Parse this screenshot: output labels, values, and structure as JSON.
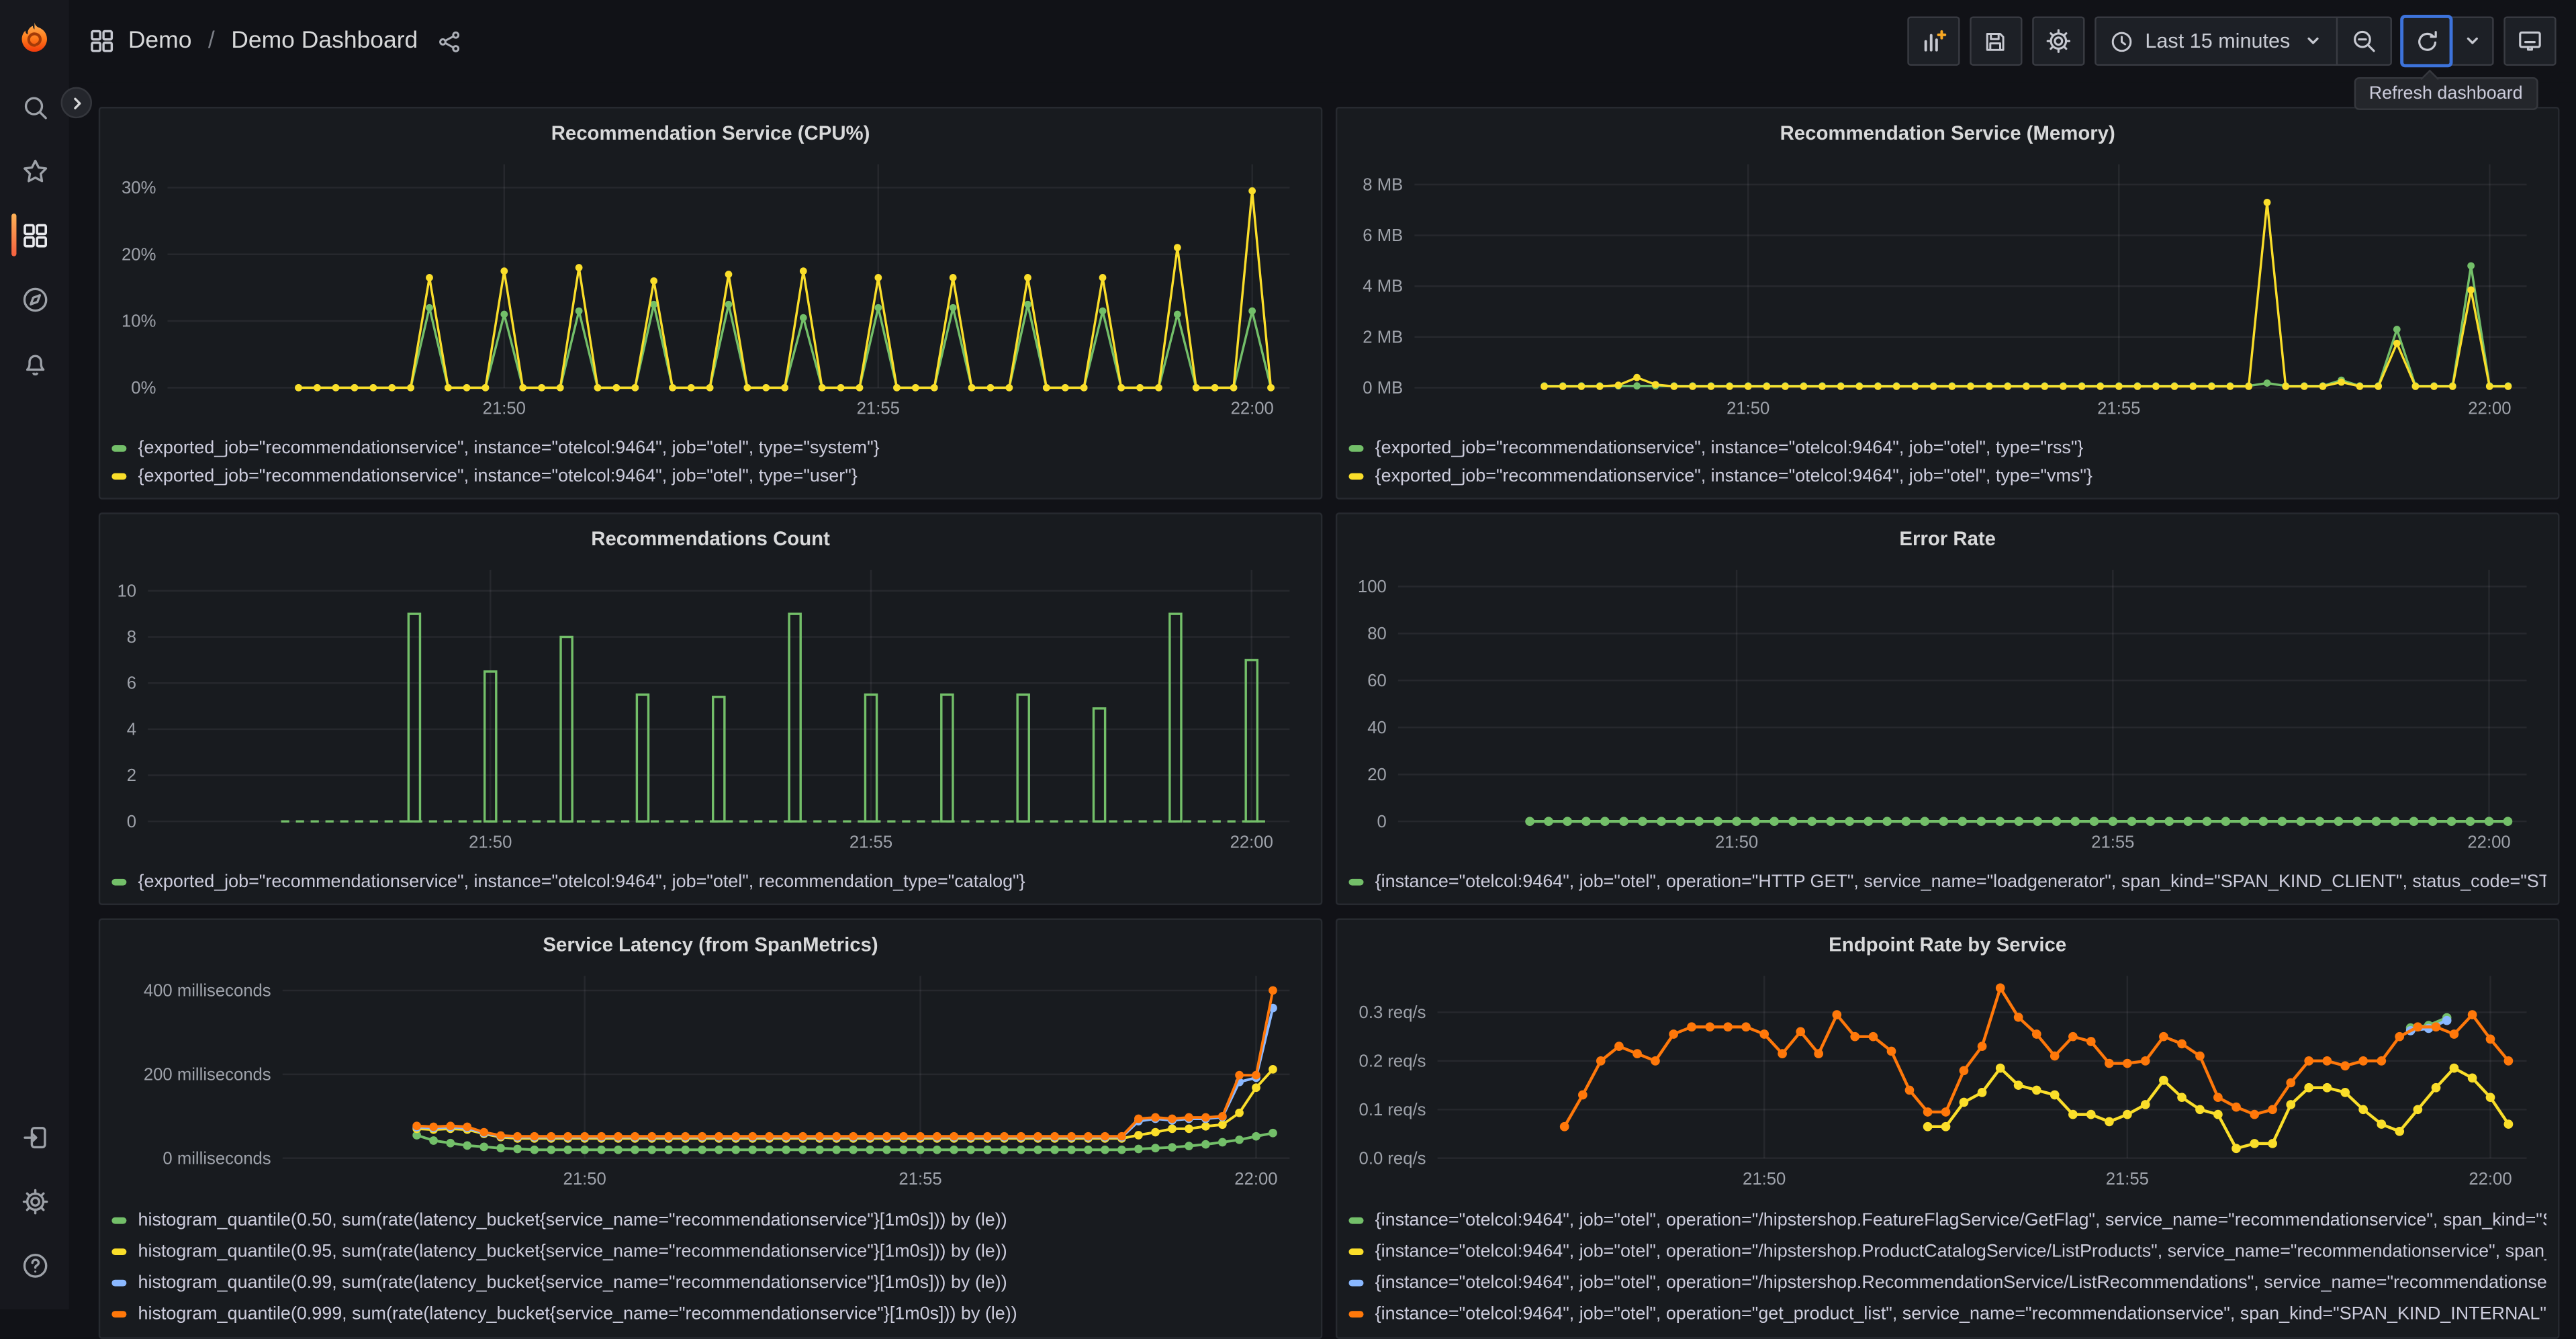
{
  "nav": {
    "section": "Demo",
    "separator": "/",
    "page": "Demo Dashboard"
  },
  "toolbar": {
    "time_label": "Last 15 minutes",
    "tooltip": "Refresh dashboard"
  },
  "sidebar": {
    "items": [
      "search",
      "starred",
      "dashboards",
      "explore",
      "alerting"
    ],
    "bottom_items": [
      "sign-in",
      "settings",
      "help"
    ],
    "active": "dashboards"
  },
  "colors": {
    "green": "#73BF69",
    "yellow": "#FADE2A",
    "blue": "#8AB8FF",
    "orange": "#FF780A",
    "accent_orange": "#FF8833",
    "focus_blue": "#3D73DB",
    "panel_bg": "#181B1F",
    "page_bg": "#111217"
  },
  "chart_data": [
    {
      "id": "cpu",
      "type": "line",
      "title": "Recommendation Service (CPU%)",
      "x_domain": [
        0,
        15
      ],
      "x_ticks": [
        {
          "t": 4.5,
          "label": "21:50"
        },
        {
          "t": 9.5,
          "label": "21:55"
        },
        {
          "t": 14.5,
          "label": "22:00"
        }
      ],
      "y_domain": [
        0,
        33.5
      ],
      "y_ticks": [
        {
          "v": 0,
          "label": "0%"
        },
        {
          "v": 10,
          "label": "10%"
        },
        {
          "v": 20,
          "label": "20%"
        },
        {
          "v": 30,
          "label": "30%"
        }
      ],
      "series": [
        {
          "name": "{exported_job=\"recommendationservice\", instance=\"otelcol:9464\", job=\"otel\", type=\"system\"}",
          "color": "#73BF69",
          "spikes": {
            "times": [
              3.5,
              4.5,
              5.5,
              6.5,
              7.5,
              8.5,
              9.5,
              10.5,
              11.5,
              12.5,
              13.5,
              14.5
            ],
            "values": [
              12,
              11,
              11.5,
              12.5,
              12.5,
              10.5,
              12,
              12,
              12.5,
              11.5,
              11,
              11.5
            ],
            "zero_from": 1.75,
            "zero_to": 14.75,
            "step": 0.25
          }
        },
        {
          "name": "{exported_job=\"recommendationservice\", instance=\"otelcol:9464\", job=\"otel\", type=\"user\"}",
          "color": "#FADE2A",
          "spikes": {
            "times": [
              3.5,
              4.5,
              5.5,
              6.5,
              7.5,
              8.5,
              9.5,
              10.5,
              11.5,
              12.5,
              13.5,
              14.5
            ],
            "values": [
              16.5,
              17.5,
              18,
              16,
              17,
              17.5,
              16.5,
              16.5,
              16.5,
              16.5,
              21,
              29.5
            ],
            "zero_from": 1.75,
            "zero_to": 14.75,
            "step": 0.25
          }
        }
      ]
    },
    {
      "id": "memory",
      "type": "line",
      "title": "Recommendation Service (Memory)",
      "x_domain": [
        0,
        15
      ],
      "x_ticks": [
        {
          "t": 4.5,
          "label": "21:50"
        },
        {
          "t": 9.5,
          "label": "21:55"
        },
        {
          "t": 14.5,
          "label": "22:00"
        }
      ],
      "y_domain": [
        0,
        8.8
      ],
      "y_ticks": [
        {
          "v": 0,
          "label": "0 MB"
        },
        {
          "v": 2,
          "label": "2 MB"
        },
        {
          "v": 4,
          "label": "4 MB"
        },
        {
          "v": 6,
          "label": "6 MB"
        },
        {
          "v": 8,
          "label": "8 MB"
        }
      ],
      "series": [
        {
          "name": "{exported_job=\"recommendationservice\", instance=\"otelcol:9464\", job=\"otel\", type=\"rss\"}",
          "color": "#73BF69",
          "flat": [
            {
              "from": 1.75,
              "to": 14.75,
              "step": 0.25,
              "value": 0.07
            }
          ],
          "points": [
            [
              11.5,
              0.18
            ],
            [
              12.5,
              0.3
            ],
            [
              13.25,
              2.3
            ],
            [
              14.25,
              4.8
            ]
          ]
        },
        {
          "name": "{exported_job=\"recommendationservice\", instance=\"otelcol:9464\", job=\"otel\", type=\"vms\"}",
          "color": "#FADE2A",
          "flat": [
            {
              "from": 1.75,
              "to": 14.75,
              "step": 0.25,
              "value": 0.05
            }
          ],
          "points": [
            [
              2.75,
              0.1
            ],
            [
              3,
              0.4
            ],
            [
              3.25,
              0.12
            ],
            [
              11.5,
              7.3
            ],
            [
              12.5,
              0.22
            ],
            [
              13.25,
              1.75
            ],
            [
              14.25,
              3.85
            ]
          ]
        }
      ]
    },
    {
      "id": "count",
      "type": "bar",
      "title": "Recommendations Count",
      "x_domain": [
        0,
        15
      ],
      "x_ticks": [
        {
          "t": 4.5,
          "label": "21:50"
        },
        {
          "t": 9.5,
          "label": "21:55"
        },
        {
          "t": 14.5,
          "label": "22:00"
        }
      ],
      "y_domain": [
        0,
        10.9
      ],
      "y_ticks": [
        {
          "v": 0,
          "label": "0"
        },
        {
          "v": 2,
          "label": "2"
        },
        {
          "v": 4,
          "label": "4"
        },
        {
          "v": 6,
          "label": "6"
        },
        {
          "v": 8,
          "label": "8"
        },
        {
          "v": 10,
          "label": "10"
        }
      ],
      "series": [
        {
          "name": "{exported_job=\"recommendationservice\", instance=\"otelcol:9464\", job=\"otel\", recommendation_type=\"catalog\"}",
          "color": "#73BF69",
          "bars": {
            "times": [
              3.5,
              4.5,
              5.5,
              6.5,
              7.5,
              8.5,
              9.5,
              10.5,
              11.5,
              12.5,
              13.5,
              14.5
            ],
            "values": [
              9,
              6.5,
              8,
              5.5,
              5.4,
              9,
              5.5,
              5.5,
              5.5,
              4.9,
              9,
              7
            ],
            "width": 7
          },
          "baseline": {
            "from": 1.75,
            "to": 14.75
          }
        }
      ]
    },
    {
      "id": "error_rate",
      "type": "line",
      "title": "Error Rate",
      "x_domain": [
        0,
        15
      ],
      "x_ticks": [
        {
          "t": 4.5,
          "label": "21:50"
        },
        {
          "t": 9.5,
          "label": "21:55"
        },
        {
          "t": 14.5,
          "label": "22:00"
        }
      ],
      "y_domain": [
        0,
        107
      ],
      "y_ticks": [
        {
          "v": 0,
          "label": "0"
        },
        {
          "v": 20,
          "label": "20"
        },
        {
          "v": 40,
          "label": "40"
        },
        {
          "v": 60,
          "label": "60"
        },
        {
          "v": 80,
          "label": "80"
        },
        {
          "v": 100,
          "label": "100"
        }
      ],
      "series": [
        {
          "name": "{instance=\"otelcol:9464\", job=\"otel\", operation=\"HTTP GET\", service_name=\"loadgenerator\", span_kind=\"SPAN_KIND_CLIENT\", status_code=\"STATUS_CODE_ERROR\"}",
          "color": "#73BF69",
          "flat": [
            {
              "from": 1.75,
              "to": 14.75,
              "step": 0.25,
              "value": 0
            }
          ]
        }
      ]
    },
    {
      "id": "latency",
      "type": "line",
      "title": "Service Latency (from SpanMetrics)",
      "x_domain": [
        0,
        15
      ],
      "x_ticks": [
        {
          "t": 4.5,
          "label": "21:50"
        },
        {
          "t": 9.5,
          "label": "21:55"
        },
        {
          "t": 14.5,
          "label": "22:00"
        }
      ],
      "y_domain": [
        0,
        435
      ],
      "y_ticks": [
        {
          "v": 0,
          "label": "0 milliseconds"
        },
        {
          "v": 200,
          "label": "200 milliseconds"
        },
        {
          "v": 400,
          "label": "400 milliseconds"
        }
      ],
      "series": [
        {
          "name": "histogram_quantile(0.50, sum(rate(latency_bucket{service_name=\"recommendationservice\"}[1m0s])) by (le))",
          "color": "#73BF69",
          "points": [
            [
              2,
              55
            ],
            [
              2.25,
              42
            ],
            [
              2.5,
              36
            ],
            [
              2.75,
              30
            ],
            [
              3,
              27
            ],
            [
              3.25,
              24
            ],
            [
              3.5,
              22
            ],
            [
              12.75,
              22
            ],
            [
              13,
              24
            ],
            [
              13.25,
              26
            ],
            [
              13.5,
              29
            ],
            [
              13.75,
              33
            ],
            [
              14,
              38
            ],
            [
              14.25,
              44
            ],
            [
              14.5,
              52
            ],
            [
              14.75,
              60
            ]
          ],
          "flat": [
            {
              "from": 3.75,
              "to": 12.5,
              "step": 0.25,
              "value": 20
            }
          ]
        },
        {
          "name": "histogram_quantile(0.95, sum(rate(latency_bucket{service_name=\"recommendationservice\"}[1m0s])) by (le))",
          "color": "#FADE2A",
          "points": [
            [
              2,
              70
            ],
            [
              2.25,
              68
            ],
            [
              2.5,
              70
            ],
            [
              2.75,
              68
            ],
            [
              3,
              58
            ],
            [
              3.25,
              50
            ],
            [
              12.75,
              55
            ],
            [
              13,
              62
            ],
            [
              13.25,
              70
            ],
            [
              13.5,
              70
            ],
            [
              13.75,
              76
            ],
            [
              14,
              80
            ],
            [
              14.25,
              108
            ],
            [
              14.5,
              168
            ],
            [
              14.75,
              212
            ]
          ],
          "flat": [
            {
              "from": 3.5,
              "to": 12.5,
              "step": 0.25,
              "value": 47
            }
          ]
        },
        {
          "name": "histogram_quantile(0.99, sum(rate(latency_bucket{service_name=\"recommendationservice\"}[1m0s])) by (le))",
          "color": "#8AB8FF",
          "points": [
            [
              2,
              74
            ],
            [
              2.25,
              72
            ],
            [
              2.5,
              74
            ],
            [
              2.75,
              72
            ],
            [
              3,
              60
            ],
            [
              3.25,
              52
            ],
            [
              12.75,
              88
            ],
            [
              13,
              94
            ],
            [
              13.25,
              90
            ],
            [
              13.5,
              94
            ],
            [
              13.75,
              94
            ],
            [
              14,
              98
            ],
            [
              14.25,
              182
            ],
            [
              14.5,
              192
            ],
            [
              14.75,
              358
            ]
          ],
          "flat": [
            {
              "from": 3.5,
              "to": 12.5,
              "step": 0.25,
              "value": 50
            }
          ]
        },
        {
          "name": "histogram_quantile(0.999, sum(rate(latency_bucket{service_name=\"recommendationservice\"}[1m0s])) by (le))",
          "color": "#FF780A",
          "points": [
            [
              2,
              77
            ],
            [
              2.25,
              75
            ],
            [
              2.5,
              77
            ],
            [
              2.75,
              75
            ],
            [
              3,
              62
            ],
            [
              3.25,
              54
            ],
            [
              12.75,
              94
            ],
            [
              13,
              97
            ],
            [
              13.25,
              94
            ],
            [
              13.5,
              97
            ],
            [
              13.75,
              97
            ],
            [
              14,
              100
            ],
            [
              14.25,
              198
            ],
            [
              14.5,
              198
            ],
            [
              14.75,
              400
            ]
          ],
          "flat": [
            {
              "from": 3.5,
              "to": 12.5,
              "step": 0.25,
              "value": 52
            }
          ]
        }
      ]
    },
    {
      "id": "endpoint_rate",
      "type": "line",
      "title": "Endpoint Rate by Service",
      "x_domain": [
        0,
        15
      ],
      "x_ticks": [
        {
          "t": 4.5,
          "label": "21:50"
        },
        {
          "t": 9.5,
          "label": "21:55"
        },
        {
          "t": 14.5,
          "label": "22:00"
        }
      ],
      "y_domain": [
        0,
        0.375
      ],
      "y_ticks": [
        {
          "v": 0,
          "label": "0.0 req/s"
        },
        {
          "v": 0.1,
          "label": "0.1 req/s"
        },
        {
          "v": 0.2,
          "label": "0.2 req/s"
        },
        {
          "v": 0.3,
          "label": "0.3 req/s"
        }
      ],
      "series": [
        {
          "name": "{instance=\"otelcol:9464\", job=\"otel\", operation=\"/hipstershop.FeatureFlagService/GetFlag\", service_name=\"recommendationservice\", span_kind=\"SPAN_KIND_SERVER\", status_code=\"STATUS_CODE_UNSET\"}",
          "color": "#73BF69",
          "points": [
            [
              13.4,
              0.268
            ],
            [
              13.65,
              0.273
            ],
            [
              13.9,
              0.289
            ]
          ]
        },
        {
          "name": "{instance=\"otelcol:9464\", job=\"otel\", operation=\"/hipstershop.ProductCatalogService/ListProducts\", service_name=\"recommendationservice\", span_kind=\"SPAN_KIND_SERVER\", status_code=\"STATUS_CODE_UNSET\"}",
          "color": "#FADE2A",
          "values_from": {
            "start": 6.75,
            "step": 0.25,
            "values": [
              0.065,
              0.065,
              0.115,
              0.135,
              0.185,
              0.15,
              0.14,
              0.13,
              0.09,
              0.09,
              0.075,
              0.09,
              0.11,
              0.16,
              0.125,
              0.1,
              0.09,
              0.02,
              0.03,
              0.03,
              0.11,
              0.145,
              0.145,
              0.135,
              0.1,
              0.07,
              0.055,
              0.1,
              0.145,
              0.185,
              0.165,
              0.125,
              0.07
            ]
          }
        },
        {
          "name": "{instance=\"otelcol:9464\", job=\"otel\", operation=\"/hipstershop.RecommendationService/ListRecommendations\", service_name=\"recommendationservice\", span_kind=\"SPAN_KIND_SERVER\", status_code=\"STATUS_CODE_UNSET\"}",
          "color": "#8AB8FF",
          "points": [
            [
              13.4,
              0.262
            ],
            [
              13.65,
              0.267
            ],
            [
              13.9,
              0.283
            ]
          ]
        },
        {
          "name": "{instance=\"otelcol:9464\", job=\"otel\", operation=\"get_product_list\", service_name=\"recommendationservice\", span_kind=\"SPAN_KIND_INTERNAL\", status_code=\"STATUS_CODE_UNSET\"}",
          "color": "#FF780A",
          "values_from": {
            "start": 1.75,
            "step": 0.25,
            "values": [
              0.065,
              0.13,
              0.2,
              0.23,
              0.215,
              0.2,
              0.255,
              0.27,
              0.27,
              0.27,
              0.27,
              0.255,
              0.215,
              0.26,
              0.215,
              0.295,
              0.25,
              0.25,
              0.22,
              0.14,
              0.095,
              0.095,
              0.18,
              0.23,
              0.35,
              0.29,
              0.255,
              0.21,
              0.25,
              0.24,
              0.195,
              0.195,
              0.2,
              0.25,
              0.235,
              0.21,
              0.125,
              0.105,
              0.09,
              0.1,
              0.155,
              0.2,
              0.2,
              0.19,
              0.2,
              0.2,
              0.25,
              0.27,
              0.27,
              0.255,
              0.295,
              0.245,
              0.2
            ]
          }
        }
      ]
    }
  ]
}
